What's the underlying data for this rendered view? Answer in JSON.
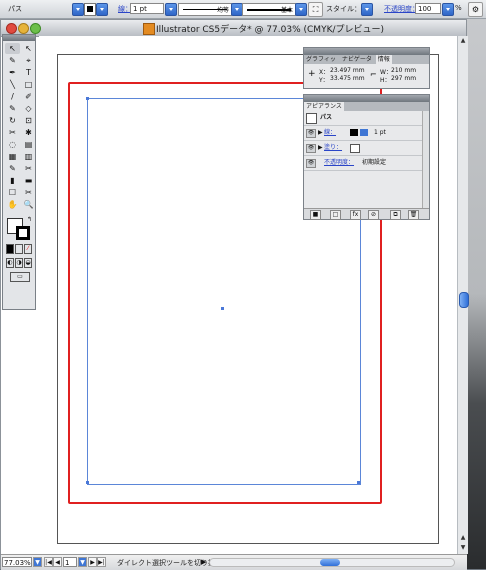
{
  "control_bar": {
    "object_type": "パス",
    "stroke_label": "線：",
    "stroke_weight": "1 pt",
    "stroke_profile": "均等",
    "brush": "基本",
    "style_label": "スタイル：",
    "opacity_label": "不透明度：",
    "opacity_value": "100",
    "percent": "%"
  },
  "window": {
    "title": "Illustrator CS5データ* @ 77.03% (CMYK/プレビュー)"
  },
  "toolbox": {
    "tools": [
      "↖",
      "↖",
      "✎",
      "⌖",
      "✒",
      "T",
      "╲",
      "□",
      "/",
      "✐",
      "✎",
      "◇",
      "↻",
      "⊡",
      "✂",
      "✱",
      "◌",
      "▤",
      "▦",
      "▥",
      "✎",
      "✂",
      "▮",
      "▬",
      "☐",
      "✂",
      "✋",
      "🔍"
    ],
    "mode_icons": [
      "■",
      "□",
      "⊘"
    ],
    "screen_icons": [
      "◐",
      "◑",
      "◒"
    ]
  },
  "info_panel": {
    "tabs": [
      "グラフィッ",
      "ナビゲータ",
      "情報"
    ],
    "x_label": "X：",
    "x_value": "23.497 mm",
    "y_label": "Y：",
    "y_value": "33.475 mm",
    "w_label": "W：",
    "w_value": "210 mm",
    "h_label": "H：",
    "h_value": "297 mm"
  },
  "appearance_panel": {
    "title": "アピアランス",
    "object": "パス",
    "rows": [
      {
        "label": "線：",
        "value": "1 pt"
      },
      {
        "label": "塗り：",
        "value": ""
      },
      {
        "label": "不透明度：",
        "value": "初期設定"
      }
    ],
    "footer_icons": [
      "■",
      "□",
      "fx",
      "⊘",
      "⧉",
      "🗑"
    ]
  },
  "status_bar": {
    "zoom": "77.03%",
    "page": "1",
    "message": "ダイレクト選択ツールを切り換え"
  },
  "colors": {
    "bleed_red": "#e02020",
    "path_blue": "#5b86d8",
    "link_blue": "#2a45c8"
  }
}
